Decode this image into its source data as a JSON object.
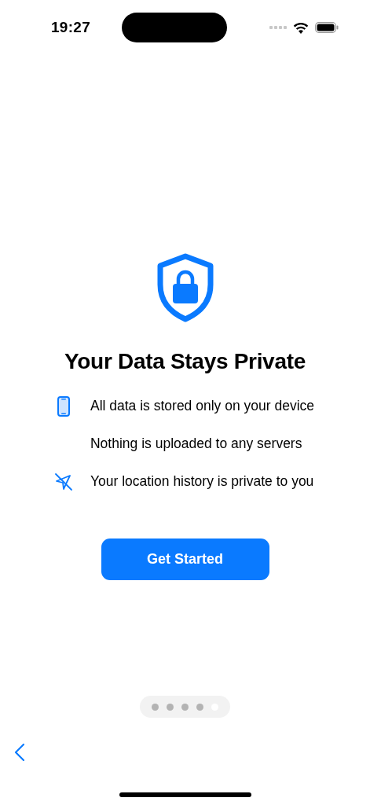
{
  "status_bar": {
    "time": "19:27"
  },
  "title": "Your Data Stays Private",
  "features": [
    {
      "kind": "phone",
      "text": "All data is stored only on your device"
    },
    {
      "kind": "none",
      "text": "Nothing is uploaded to any servers"
    },
    {
      "kind": "location-slash",
      "text": "Your location history is private to you"
    }
  ],
  "button": "Get Started",
  "pages": [
    {
      "selected": false
    },
    {
      "selected": false
    },
    {
      "selected": false
    },
    {
      "selected": false
    },
    {
      "selected": true
    }
  ]
}
